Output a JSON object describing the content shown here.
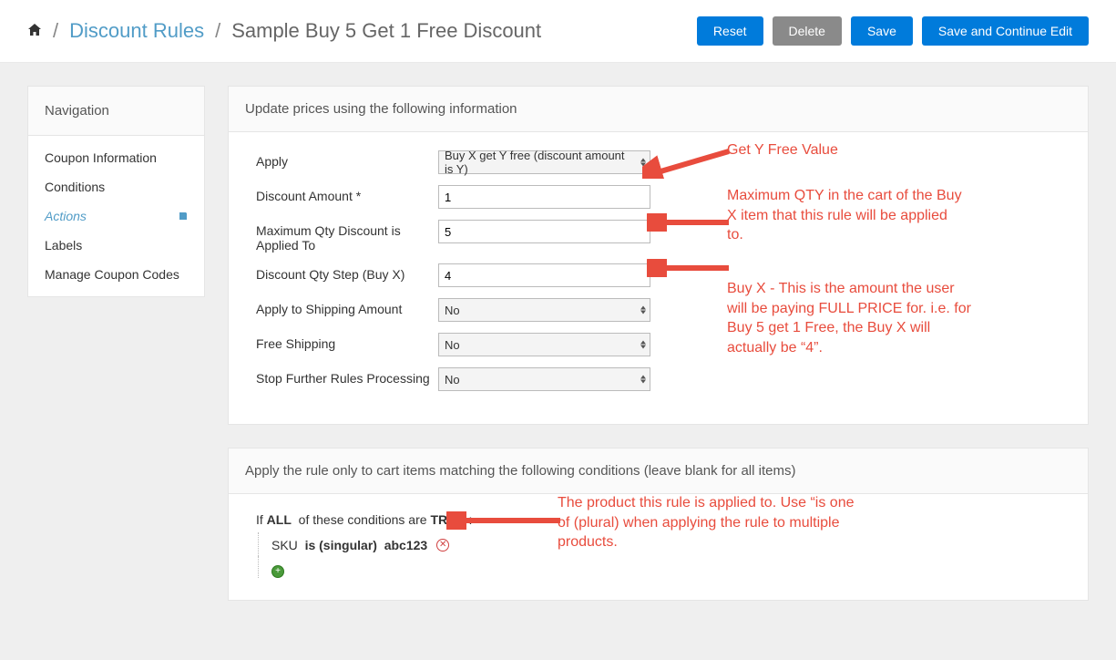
{
  "breadcrumb": {
    "link": "Discount Rules",
    "title": "Sample Buy 5 Get 1 Free Discount"
  },
  "buttons": {
    "reset": "Reset",
    "delete": "Delete",
    "save": "Save",
    "save_continue": "Save and Continue Edit"
  },
  "sidebar": {
    "title": "Navigation",
    "items": [
      "Coupon Information",
      "Conditions",
      "Actions",
      "Labels",
      "Manage Coupon Codes"
    ]
  },
  "panel1": {
    "title": "Update prices using the following information",
    "labels": {
      "apply": "Apply",
      "discount_amount": "Discount Amount *",
      "max_qty": "Maximum Qty Discount is Applied To",
      "qty_step": "Discount Qty Step (Buy X)",
      "apply_shipping": "Apply to Shipping Amount",
      "free_shipping": "Free Shipping",
      "stop_rules": "Stop Further Rules Processing"
    },
    "values": {
      "apply": "Buy X get Y free (discount amount is Y)",
      "discount_amount": "1",
      "max_qty": "5",
      "qty_step": "4",
      "apply_shipping": "No",
      "free_shipping": "No",
      "stop_rules": "No"
    }
  },
  "panel2": {
    "title": "Apply the rule only to cart items matching the following conditions (leave blank for all items)",
    "cond": {
      "prefix": "If",
      "all": "ALL",
      "mid": "of these conditions are",
      "true": "TRUE",
      "suffix": ":",
      "sku_label": "SKU",
      "sku_op": "is (singular)",
      "sku_val": "abc123"
    }
  },
  "annotations": {
    "a1": "Get Y Free Value",
    "a2": "Maximum QTY in the cart of the Buy X item that this rule will be applied to.",
    "a3": "Buy X - This is the amount the user will be paying FULL PRICE for. i.e. for Buy 5 get 1 Free, the Buy X will actually be “4”.",
    "a4": "The product this rule is applied to. Use “is one of (plural) when applying the rule to multiple products."
  }
}
